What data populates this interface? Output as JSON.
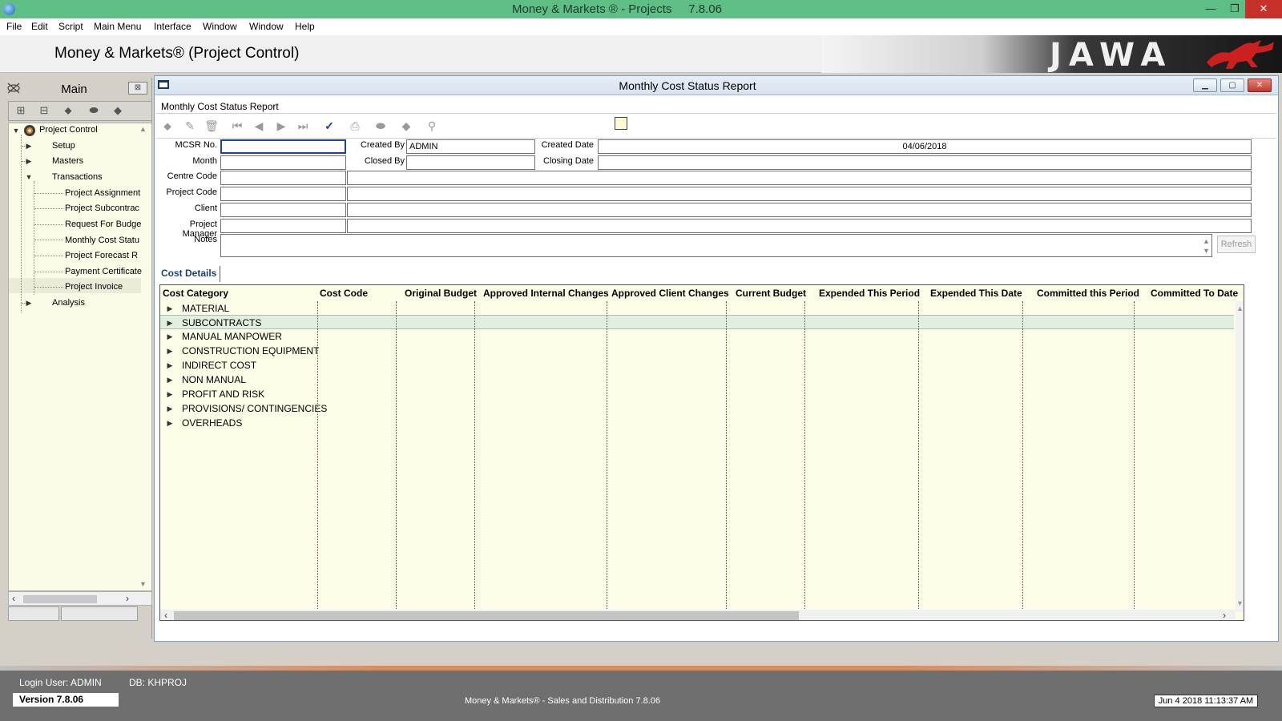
{
  "window": {
    "title": "Money & Markets ® - Projects",
    "version": "7.8.06",
    "min": "—",
    "restore": "❐",
    "close": "✕"
  },
  "menu": [
    "File",
    "Edit",
    "Script",
    "Main Menu",
    "Interface",
    "Window",
    "Window",
    "Help"
  ],
  "header": {
    "app_title": "Money & Markets® (Project Control)",
    "logo_text": "JAWA"
  },
  "side": {
    "title": "Main",
    "close": "⊠",
    "tree": {
      "root": "Project Control",
      "setup": "Setup",
      "masters": "Masters",
      "transactions": "Transactions",
      "items": [
        "Project Assignment",
        "Project Subcontrac",
        "Request For Budge",
        "Monthly Cost Statu",
        "Project Forecast R",
        "Payment Certificate",
        "Project Invoice"
      ],
      "analysis": "Analysis"
    }
  },
  "child": {
    "title": "Monthly Cost Status Report",
    "subtitle": "Monthly Cost Status Report"
  },
  "form": {
    "labels": {
      "mcsr_no": "MCSR No.",
      "month": "Month",
      "centre_code": "Centre Code",
      "project_code": "Project Code",
      "client": "Client",
      "project_manager": "Project Manager",
      "notes": "Notes",
      "created_by": "Created By",
      "closed_by": "Closed By",
      "created_date": "Created Date",
      "closing_date": "Closing Date"
    },
    "values": {
      "created_by": "ADMIN",
      "created_date": "04/06/2018"
    },
    "refresh": "Refresh"
  },
  "tab": "Cost Details",
  "grid": {
    "columns": [
      "Cost Category",
      "Cost Code",
      "Original Budget",
      "Approved Internal Changes",
      "Approved Client Changes",
      "Current Budget",
      "Expended This Period",
      "Expended This Date",
      "Committed this Period",
      "Committed To Date"
    ],
    "rows": [
      "MATERIAL",
      "SUBCONTRACTS",
      "MANUAL MANPOWER",
      "CONSTRUCTION EQUIPMENT",
      "INDIRECT COST",
      "NON MANUAL",
      "PROFIT AND RISK",
      "PROVISIONS/ CONTINGENCIES",
      "OVERHEADS"
    ],
    "selected_row": 1
  },
  "status": {
    "login": "Login User: ADMIN",
    "db": "DB: KHPROJ",
    "version": "Version 7.8.06",
    "product": "Money & Markets® - Sales and Distribution  7.8.06",
    "clock": "Jun 4 2018  11:13:37 AM"
  },
  "colors": {
    "titlebar": "#5fbd86",
    "grid_bg": "#fdfde7",
    "tab_text": "#1d3f7a",
    "statusbar": "#6f6f6f"
  }
}
